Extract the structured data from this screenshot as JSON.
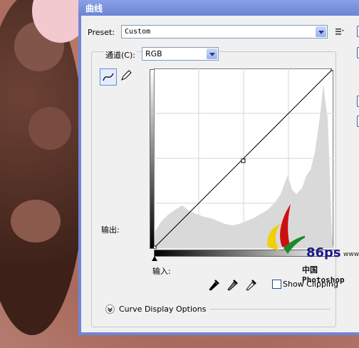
{
  "dialog": {
    "title": "曲线"
  },
  "preset": {
    "label": "Preset:",
    "value": "Custom"
  },
  "channel": {
    "label": "通道(C):",
    "value": "RGB"
  },
  "graph": {
    "output_label": "输出:",
    "input_label": "输入:"
  },
  "options": {
    "show_clipping_label": "Show Clipping",
    "curve_display_label": "Curve Display Options"
  },
  "watermark": {
    "text": "86ps",
    "sub": "中国Photoshop",
    "www": "www"
  },
  "icons": [
    "curve-tool-icon",
    "pencil-icon",
    "preset-menu-icon",
    "black-eyedropper-icon",
    "gray-eyedropper-icon",
    "white-eyedropper-icon",
    "expand-icon"
  ]
}
